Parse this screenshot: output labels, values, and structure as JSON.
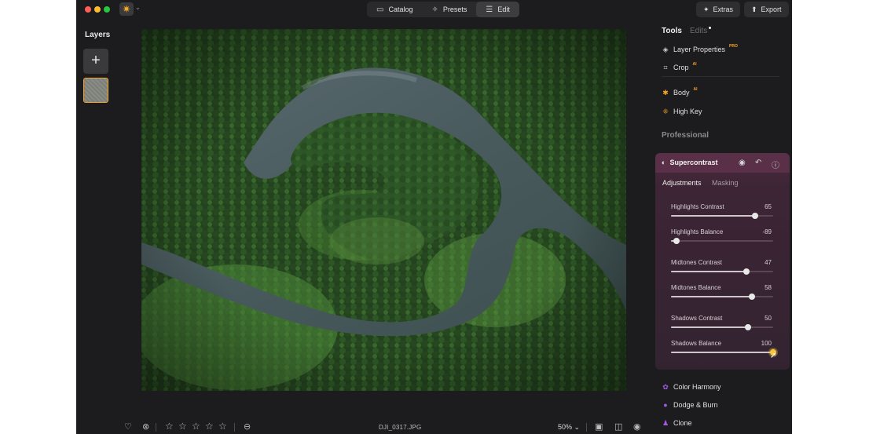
{
  "titlebar": {
    "app_icon": "sun-logo-icon",
    "modes": [
      {
        "label": "Catalog",
        "icon": "folder-icon",
        "active": false
      },
      {
        "label": "Presets",
        "icon": "wand-icon",
        "active": false
      },
      {
        "label": "Edit",
        "icon": "sliders-icon",
        "active": true
      }
    ],
    "extras_label": "Extras",
    "export_label": "Export"
  },
  "layers": {
    "title": "Layers",
    "add_icon": "plus-icon"
  },
  "bottom_bar": {
    "filename": "DJI_0317.JPG",
    "zoom": "50%",
    "rating": 0,
    "max_rating": 5
  },
  "right_panel": {
    "tabs": {
      "tools": "Tools",
      "edits": "Edits"
    },
    "top_tools": [
      {
        "label": "Layer Properties",
        "badge": "PRO",
        "icon": "layers-icon"
      },
      {
        "label": "Crop",
        "badge": "AI",
        "icon": "crop-icon"
      }
    ],
    "body_tools": [
      {
        "label": "Body",
        "badge": "AI",
        "icon": "body-icon",
        "color": "#f5a623"
      },
      {
        "label": "High Key",
        "badge": "",
        "icon": "high-key-icon",
        "color": "#f5a623"
      }
    ],
    "section_professional": "Professional",
    "supercontrast": {
      "title": "Supercontrast",
      "tabs": {
        "adjustments": "Adjustments",
        "masking": "Masking"
      },
      "sliders": [
        {
          "label": "Highlights Contrast",
          "value": "65",
          "pos": 0.825
        },
        {
          "label": "Highlights Balance",
          "value": "-89",
          "pos": 0.055
        },
        {
          "label": "Midtones Contrast",
          "value": "47",
          "pos": 0.735
        },
        {
          "label": "Midtones Balance",
          "value": "58",
          "pos": 0.79
        },
        {
          "label": "Shadows Contrast",
          "value": "50",
          "pos": 0.75
        },
        {
          "label": "Shadows Balance",
          "value": "100",
          "pos": 1.0
        }
      ]
    },
    "bottom_tools": [
      {
        "label": "Color Harmony",
        "icon": "color-harmony-icon",
        "color": "#a259e6"
      },
      {
        "label": "Dodge & Burn",
        "icon": "dodge-burn-icon",
        "color": "#a259e6"
      },
      {
        "label": "Clone",
        "icon": "clone-icon",
        "color": "#a259e6"
      }
    ]
  }
}
